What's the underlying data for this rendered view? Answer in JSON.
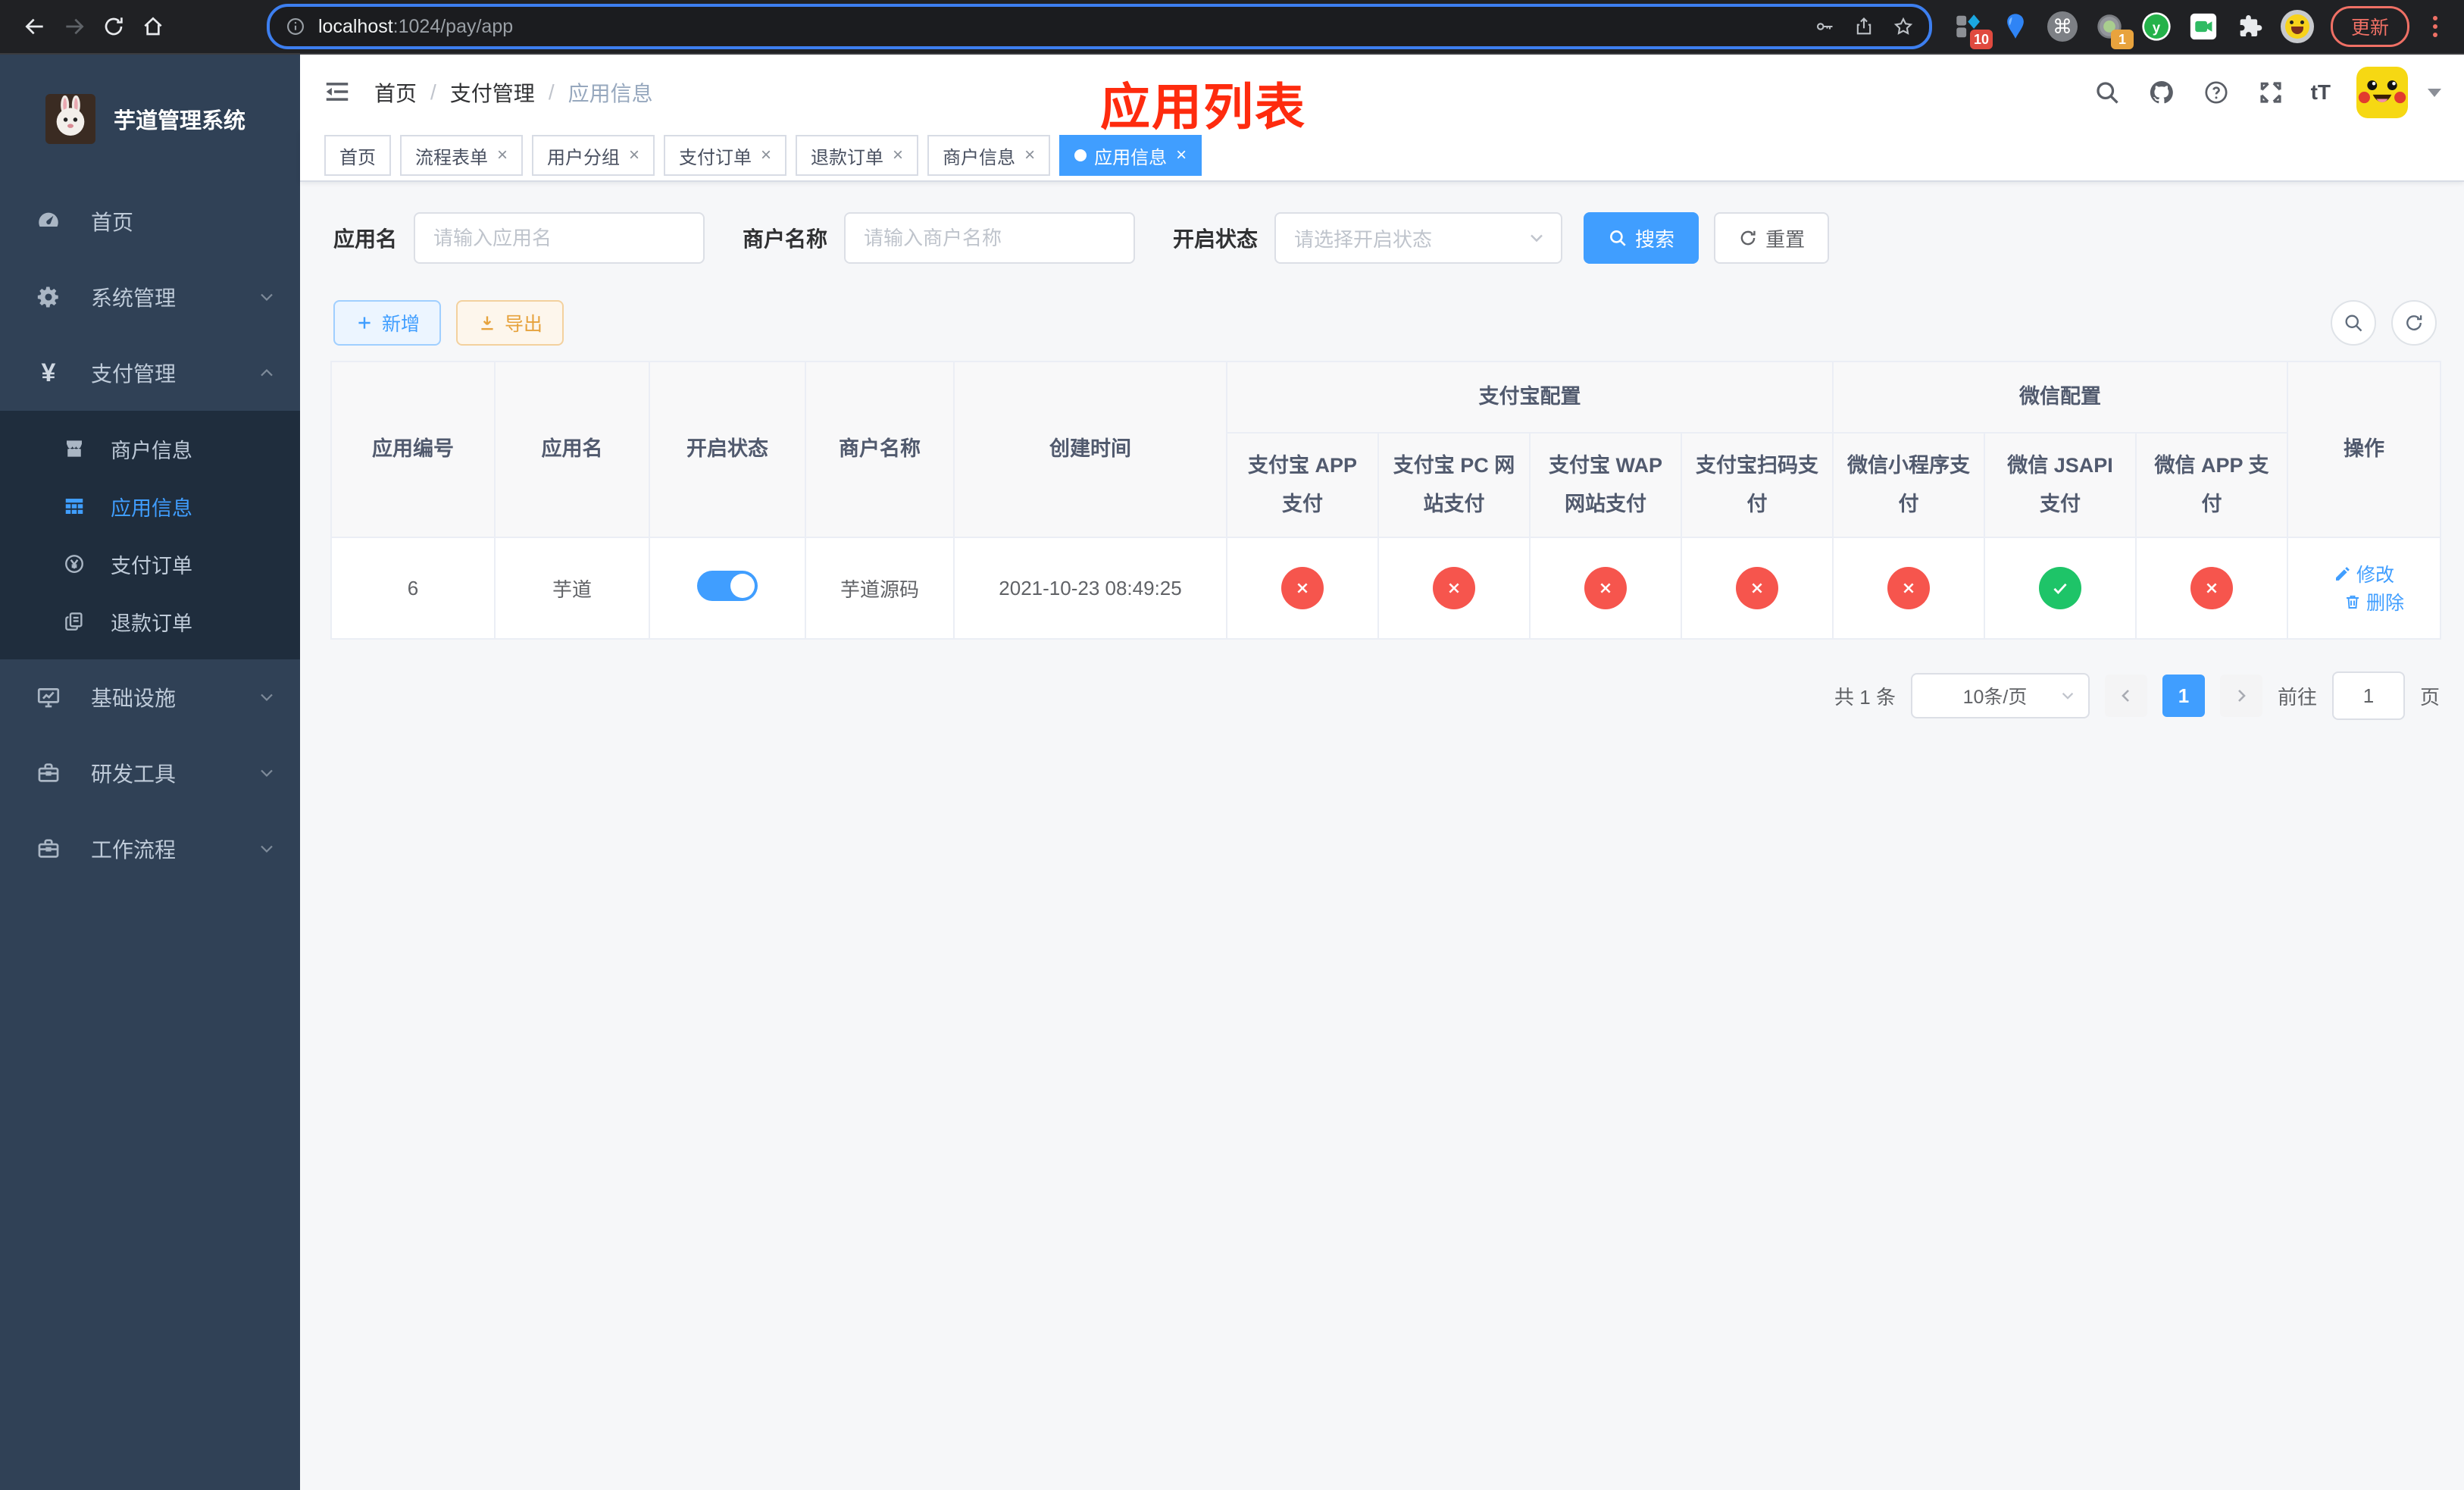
{
  "colors": {
    "accent_blue": "#409eff",
    "success_green": "#1ec468",
    "danger_red": "#f6554d",
    "annotation_red": "#fe2b0e",
    "warning_orange": "#e6a23c"
  },
  "browser": {
    "url_host": "localhost",
    "url_rest": ":1024/pay/app",
    "update_label": "更新",
    "ext_badge_blocks": "10",
    "ext_badge_circle": "1",
    "ext_y_letter": "y",
    "cmd_glyph": "⌘"
  },
  "sidebar": {
    "title": "芋道管理系统",
    "items": [
      {
        "label": "首页",
        "icon": "dashboard-icon",
        "level": "top"
      },
      {
        "label": "系统管理",
        "icon": "gear-icon",
        "level": "top",
        "chevron": "down"
      },
      {
        "label": "支付管理",
        "icon": "yuan-icon",
        "level": "top",
        "chevron": "up"
      },
      {
        "label": "商户信息",
        "icon": "shop-icon",
        "level": "sub"
      },
      {
        "label": "应用信息",
        "icon": "grid-icon",
        "level": "sub",
        "active": true
      },
      {
        "label": "支付订单",
        "icon": "coin-icon",
        "level": "sub"
      },
      {
        "label": "退款订单",
        "icon": "document-icon",
        "level": "sub"
      },
      {
        "label": "基础设施",
        "icon": "monitor-icon",
        "level": "top",
        "chevron": "down"
      },
      {
        "label": "研发工具",
        "icon": "toolbox-icon",
        "level": "top",
        "chevron": "down"
      },
      {
        "label": "工作流程",
        "icon": "briefcase-icon",
        "level": "top",
        "chevron": "down"
      }
    ]
  },
  "header": {
    "breadcrumb": [
      "首页",
      "支付管理",
      "应用信息"
    ],
    "separator": "/",
    "annotation": "应用列表"
  },
  "tabs": [
    {
      "label": "首页",
      "closable": false,
      "active": false
    },
    {
      "label": "流程表单",
      "closable": true,
      "active": false
    },
    {
      "label": "用户分组",
      "closable": true,
      "active": false
    },
    {
      "label": "支付订单",
      "closable": true,
      "active": false
    },
    {
      "label": "退款订单",
      "closable": true,
      "active": false
    },
    {
      "label": "商户信息",
      "closable": true,
      "active": false
    },
    {
      "label": "应用信息",
      "closable": true,
      "active": true
    }
  ],
  "filters": {
    "app_name_label": "应用名",
    "app_name_placeholder": "请输入应用名",
    "merchant_label": "商户名称",
    "merchant_placeholder": "请输入商户名称",
    "status_label": "开启状态",
    "status_placeholder": "请选择开启状态",
    "search_label": "搜索",
    "reset_label": "重置"
  },
  "toolbar": {
    "add_label": "新增",
    "export_label": "导出"
  },
  "table": {
    "plain_columns": [
      "应用编号",
      "应用名",
      "开启状态",
      "商户名称",
      "创建时间"
    ],
    "groups": [
      {
        "label": "支付宝配置",
        "columns": [
          "支付宝 APP 支付",
          "支付宝 PC 网站支付",
          "支付宝 WAP 网站支付",
          "支付宝扫码支付"
        ]
      },
      {
        "label": "微信配置",
        "columns": [
          "微信小程序支付",
          "微信 JSAPI 支付",
          "微信 APP 支付"
        ]
      }
    ],
    "action_column": "操作",
    "rows": [
      {
        "id": "6",
        "name": "芋道",
        "enabled": true,
        "merchant": "芋道源码",
        "created": "2021-10-23 08:49:25",
        "channels": [
          false,
          false,
          false,
          false,
          false,
          true,
          false
        ],
        "edit_label": "修改",
        "delete_label": "删除"
      }
    ]
  },
  "pagination": {
    "total": "共 1 条",
    "page_size": "10条/页",
    "current_page": "1",
    "goto_label": "前往",
    "goto_value": "1",
    "goto_unit": "页"
  }
}
